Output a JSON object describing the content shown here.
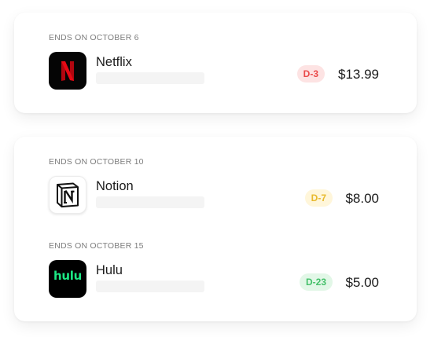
{
  "subscriptions": {
    "groups": [
      {
        "label": "ENDS ON OCTOBER 6",
        "items": [
          {
            "name": "Netflix",
            "icon": "netflix-logo-icon",
            "badge": "D-3",
            "badge_color": "#ea4a4a",
            "price": "$13.99"
          }
        ]
      },
      {
        "label": "ENDS ON OCTOBER 10",
        "items": [
          {
            "name": "Notion",
            "icon": "notion-logo-icon",
            "badge": "D-7",
            "badge_color": "#e8b92c",
            "price": "$8.00"
          }
        ]
      },
      {
        "label": "ENDS ON OCTOBER 15",
        "items": [
          {
            "name": "Hulu",
            "icon": "hulu-logo-icon",
            "icon_text": "hulu",
            "icon_text_color": "#1ce783",
            "badge": "D-23",
            "badge_color": "#45c06a",
            "price": "$5.00"
          }
        ]
      }
    ]
  }
}
